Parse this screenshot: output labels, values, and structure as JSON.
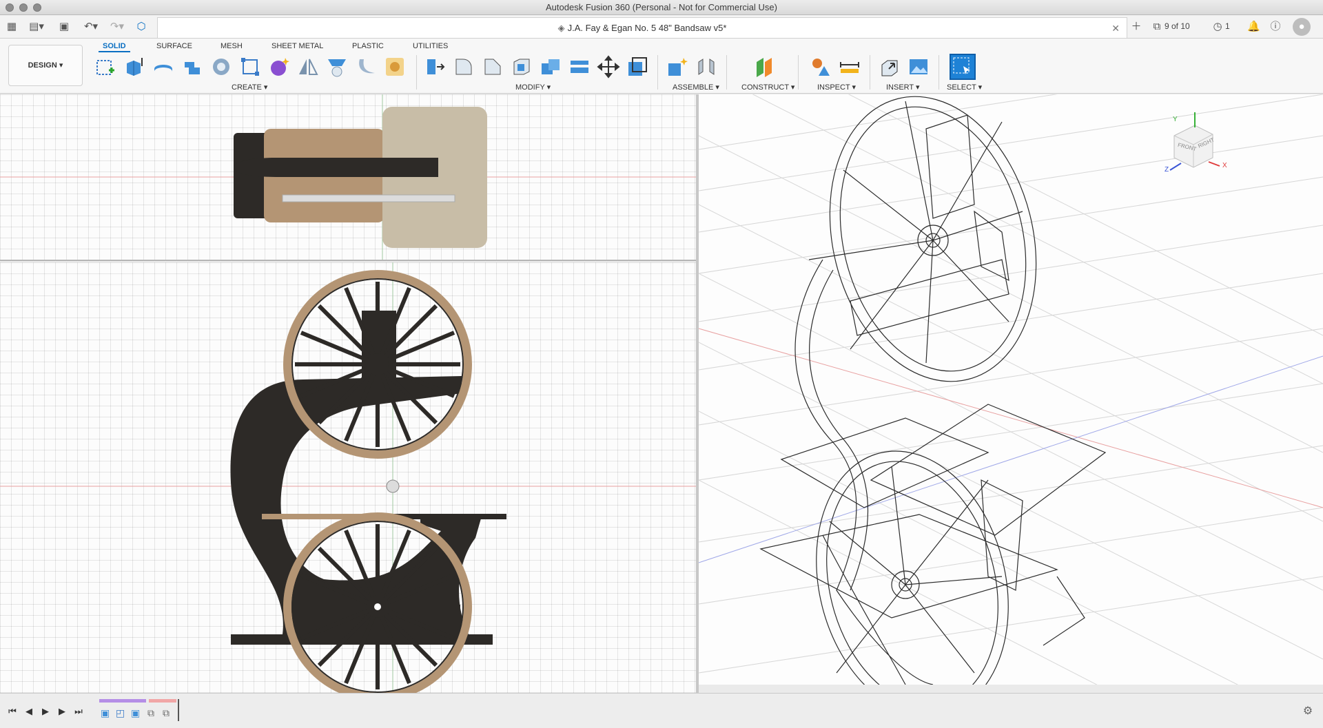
{
  "window": {
    "title": "Autodesk Fusion 360 (Personal - Not for Commercial Use)"
  },
  "tabbar": {
    "document_title": "J.A. Fay & Egan No. 5 48\" Bandsaw v5*",
    "version_counter": "9 of 10",
    "jobs_count": "1",
    "icons": [
      "grid-icon",
      "file-icon",
      "save-icon",
      "undo-icon",
      "redo-icon",
      "data-panel-icon",
      "close-icon",
      "new-tab-icon",
      "versions-icon",
      "clock-icon",
      "bell-icon",
      "help-icon",
      "user-icon"
    ]
  },
  "toolbar": {
    "workspace": "DESIGN",
    "tabs": [
      "SOLID",
      "SURFACE",
      "MESH",
      "SHEET METAL",
      "PLASTIC",
      "UTILITIES"
    ],
    "active_tab": "SOLID",
    "groups": {
      "create": "CREATE",
      "modify": "MODIFY",
      "assemble": "ASSEMBLE",
      "construct": "CONSTRUCT",
      "inspect": "INSPECT",
      "insert": "INSERT",
      "select": "SELECT"
    }
  },
  "viewcube": {
    "front": "FRONT",
    "right": "RIGHT",
    "axis_x": "X",
    "axis_y": "Y",
    "axis_z": "Z"
  },
  "timeline": {
    "icons": [
      "first-icon",
      "prev-icon",
      "play-icon",
      "next-icon",
      "last-icon",
      "settings-icon"
    ]
  },
  "colors": {
    "accent": "#0a6fc2",
    "wood": "#b49574",
    "cast_iron": "#2d2a27",
    "table_top": "#c8bda7"
  }
}
